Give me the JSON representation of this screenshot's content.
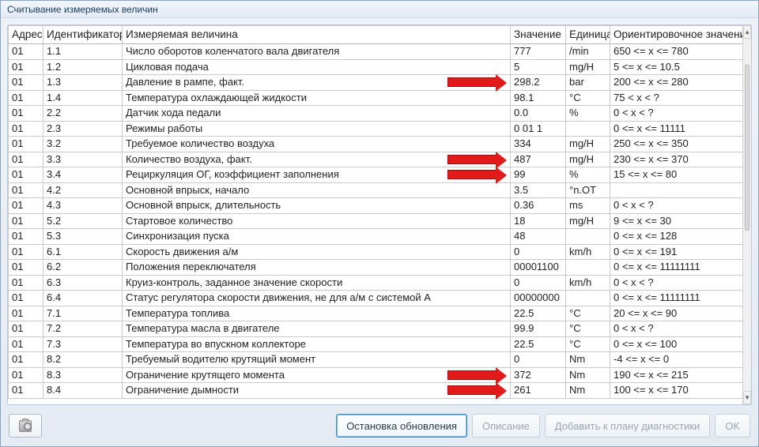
{
  "window": {
    "title": "Считывание измеряемых величин"
  },
  "columns": {
    "addr": "Адрес",
    "id": "Идентификатор",
    "name": "Измеряемая величина",
    "val": "Значение",
    "unit": "Единица",
    "ref": "Ориентировочное значение"
  },
  "rows": [
    {
      "addr": "01",
      "id": "1.1",
      "name": "Число оборотов коленчатого вала двигателя",
      "val": "777",
      "unit": "/min",
      "ref": "650 <= x <= 780"
    },
    {
      "addr": "01",
      "id": "1.2",
      "name": "Цикловая подача",
      "val": "5",
      "unit": "mg/H",
      "ref": "5 <= x <= 10.5"
    },
    {
      "addr": "01",
      "id": "1.3",
      "name": "Давление в рампе, факт.",
      "val": "298.2",
      "unit": "bar",
      "ref": "200 <= x <= 280"
    },
    {
      "addr": "01",
      "id": "1.4",
      "name": "Температура охлаждающей жидкости",
      "val": "98.1",
      "unit": "°C",
      "ref": "75 < x < ?"
    },
    {
      "addr": "01",
      "id": "2.2",
      "name": "Датчик хода педали",
      "val": "0.0",
      "unit": "%",
      "ref": "0 < x < ?"
    },
    {
      "addr": "01",
      "id": "2.3",
      "name": "Режимы работы",
      "val": "0 01  1",
      "unit": "",
      "ref": "0 <= x <= 11111"
    },
    {
      "addr": "01",
      "id": "3.2",
      "name": "Требуемое количество воздуха",
      "val": "334",
      "unit": "mg/H",
      "ref": "250 <= x <= 350"
    },
    {
      "addr": "01",
      "id": "3.3",
      "name": "Количество воздуха, факт.",
      "val": "487",
      "unit": "mg/H",
      "ref": "230 <= x <= 370"
    },
    {
      "addr": "01",
      "id": "3.4",
      "name": "Рециркуляция ОГ, коэффициент заполнения",
      "val": "99",
      "unit": "%",
      "ref": "15 <= x <= 80"
    },
    {
      "addr": "01",
      "id": "4.2",
      "name": "Основной впрыск, начало",
      "val": "3.5",
      "unit": "°n.OT",
      "ref": ""
    },
    {
      "addr": "01",
      "id": "4.3",
      "name": "Основной впрыск, длительность",
      "val": "0.36",
      "unit": "ms",
      "ref": "0 < x < ?"
    },
    {
      "addr": "01",
      "id": "5.2",
      "name": "Стартовое количество",
      "val": "18",
      "unit": "mg/H",
      "ref": "9 <= x <= 30"
    },
    {
      "addr": "01",
      "id": "5.3",
      "name": "Синхронизация пуска",
      "val": "48",
      "unit": "",
      "ref": "0 <= x <= 128"
    },
    {
      "addr": "01",
      "id": "6.1",
      "name": "Скорость движения а/м",
      "val": "0",
      "unit": "km/h",
      "ref": "0 <= x <= 191"
    },
    {
      "addr": "01",
      "id": "6.2",
      "name": "Положения переключателя",
      "val": "00001100",
      "unit": "",
      "ref": "0 <= x <= 11111111"
    },
    {
      "addr": "01",
      "id": "6.3",
      "name": "Круиз-контроль, заданное значение скорости",
      "val": "0",
      "unit": "km/h",
      "ref": "0 < x < ?"
    },
    {
      "addr": "01",
      "id": "6.4",
      "name": "Статус регулятора скорости движения, не для а/м с системой А",
      "val": "00000000",
      "unit": "",
      "ref": "0 <= x <= 11111111"
    },
    {
      "addr": "01",
      "id": "7.1",
      "name": "Температура топлива",
      "val": "22.5",
      "unit": "°C",
      "ref": "20 <= x <= 90"
    },
    {
      "addr": "01",
      "id": "7.2",
      "name": "Температура масла в двигателе",
      "val": "99.9",
      "unit": "°C",
      "ref": "0 < x < ?"
    },
    {
      "addr": "01",
      "id": "7.3",
      "name": "Температура во впускном коллекторе",
      "val": "22.5",
      "unit": "°C",
      "ref": "0 <= x <= 100"
    },
    {
      "addr": "01",
      "id": "8.2",
      "name": "Требуемый водителю крутящий момент",
      "val": "0",
      "unit": "Nm",
      "ref": "-4 <= x <= 0"
    },
    {
      "addr": "01",
      "id": "8.3",
      "name": "Ограничение крутящего момента",
      "val": "372",
      "unit": "Nm",
      "ref": "190 <= x <= 215"
    },
    {
      "addr": "01",
      "id": "8.4",
      "name": "Ограничение дымности",
      "val": "261",
      "unit": "Nm",
      "ref": "100 <= x <= 170"
    }
  ],
  "buttons": {
    "stop_update": "Остановка обновления",
    "description": "Описание",
    "add_to_plan": "Добавить к плану диагностики",
    "ok": "OK"
  },
  "annotations": {
    "arrows_at": [
      2,
      7,
      8,
      21,
      22
    ]
  }
}
